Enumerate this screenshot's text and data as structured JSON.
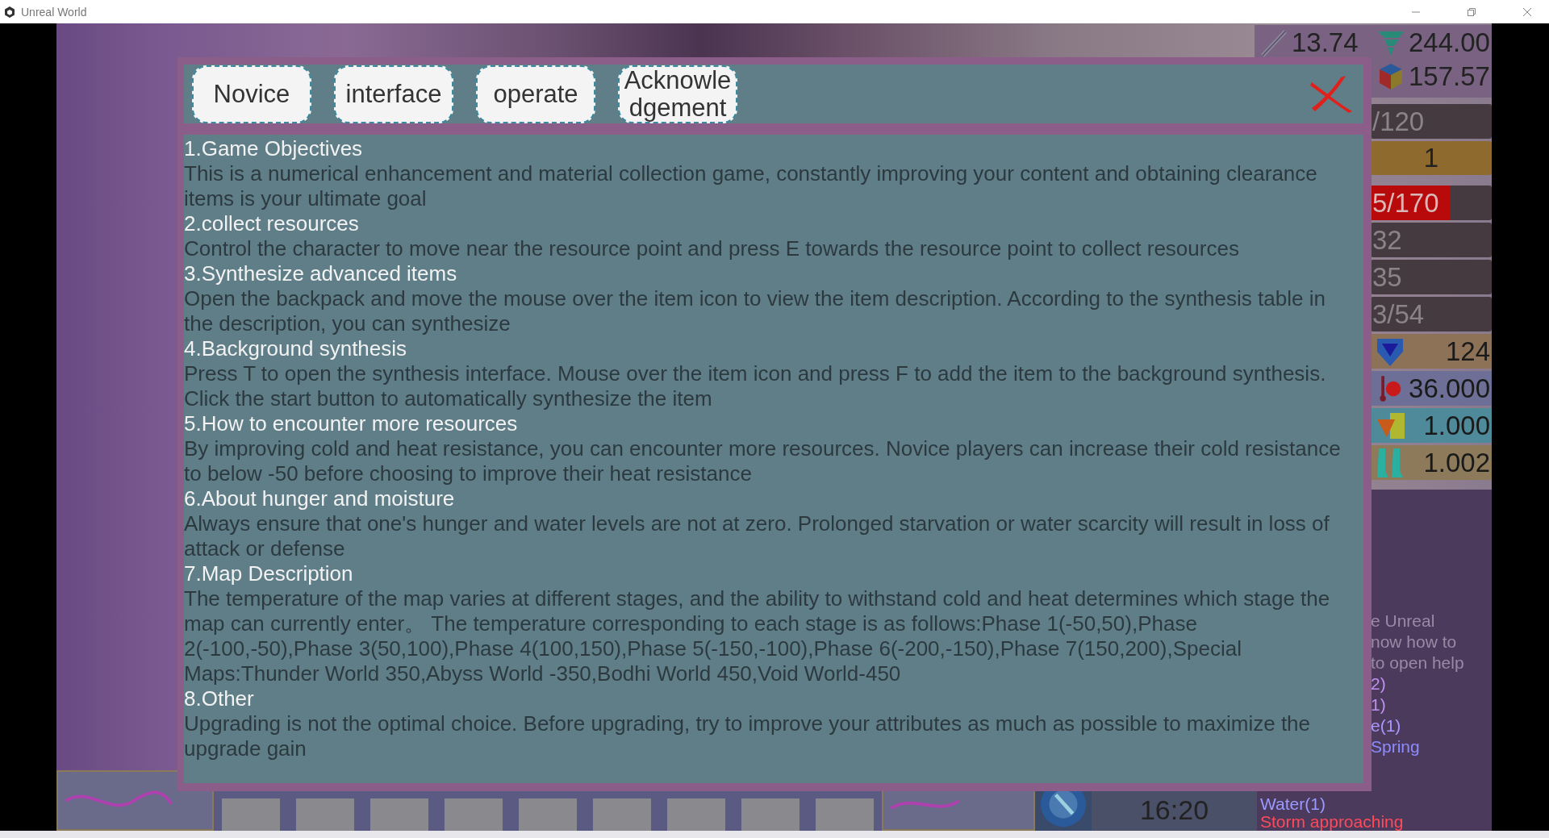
{
  "window": {
    "title": "Unreal World"
  },
  "hud": {
    "top_stats": [
      {
        "value": "13.74"
      },
      {
        "value": "244.00"
      },
      {
        "value": "157.57"
      }
    ],
    "rows": [
      {
        "kind": "plain",
        "text": "/120"
      },
      {
        "kind": "badge",
        "text": "1"
      },
      {
        "kind": "bar",
        "text": "5/170",
        "level": 0.65
      },
      {
        "kind": "plain",
        "text": "32"
      },
      {
        "kind": "plain",
        "text": "35"
      },
      {
        "kind": "plain",
        "text": "3/54"
      }
    ],
    "attributes": [
      {
        "value": "124"
      },
      {
        "value": "36.000"
      },
      {
        "value": "1.000"
      },
      {
        "value": "1.002"
      }
    ]
  },
  "log": [
    {
      "text": "e Unreal",
      "color": "#9a8aa6"
    },
    {
      "text": "now how to",
      "color": "#9a8aa6"
    },
    {
      "text": "to open help",
      "color": "#9a8aa6"
    },
    {
      "text": "2)",
      "color": "#c090f0"
    },
    {
      "text": "1)",
      "color": "#c090f0"
    },
    {
      "text": "e(1)",
      "color": "#a898ff"
    },
    {
      "text": "Spring",
      "color": "#8c8cff"
    }
  ],
  "bottom_log": [
    {
      "text": "Water(1)",
      "color": "#9a9aff"
    },
    {
      "text": "Storm approaching",
      "color": "#ff4a5a"
    }
  ],
  "clock": {
    "time": "16:20"
  },
  "dialog": {
    "tabs": [
      {
        "label": "Novice"
      },
      {
        "label": "interface"
      },
      {
        "label": "operate"
      },
      {
        "label": "Acknowledgement"
      }
    ],
    "sections": [
      {
        "heading": "1.Game Objectives",
        "body": "This is a numerical enhancement and material collection game, constantly improving your content and obtaining clearance items is your ultimate goal"
      },
      {
        "heading": "2.collect resources",
        "body": "Control the character to move near the resource point and press E towards the resource point to collect resources"
      },
      {
        "heading": "3.Synthesize advanced items",
        "body": "Open the backpack and move the mouse over the item icon to view the item description. According to the synthesis table in the description, you can synthesize"
      },
      {
        "heading": "4.Background synthesis",
        "body": "Press T to open the synthesis interface. Mouse over the item icon and press F to add the item to the background synthesis. Click the start button to automatically synthesize the item"
      },
      {
        "heading": "5.How to encounter more resources",
        "body": "By improving cold and heat resistance, you can encounter more resources. Novice players can increase their cold resistance to below -50 before choosing to improve their heat resistance"
      },
      {
        "heading": "6.About hunger and moisture",
        "body": "Always ensure that one's hunger and water levels are not at zero. Prolonged starvation or water scarcity will result in loss of attack or defense"
      },
      {
        "heading": "7.Map Description",
        "body": "The temperature of the map varies at different stages, and the ability to withstand cold and heat determines which stage the map can currently enter。 The temperature corresponding to each stage is as follows:Phase 1(-50,50),Phase 2(-100,-50),Phase 3(50,100),Phase 4(100,150),Phase 5(-150,-100),Phase 6(-200,-150),Phase 7(150,200),Special Maps:Thunder World 350,Abyss World -350,Bodhi World 450,Void World-450"
      },
      {
        "heading": "8.Other",
        "body": "Upgrading is not the optimal choice. Before upgrading, try to improve your attributes as much as possible to maximize the upgrade gain"
      }
    ]
  }
}
